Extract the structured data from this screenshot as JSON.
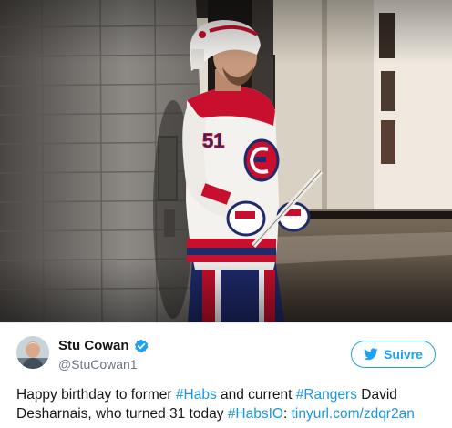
{
  "photo": {
    "jersey_number": "51"
  },
  "tweet": {
    "display_name": "Stu Cowan",
    "handle": "@StuCowan1",
    "follow_label": "Suivre",
    "text_parts": {
      "t1": "Happy birthday to former ",
      "hashtag_habs": "#Habs",
      "t2": " and current ",
      "hashtag_rangers": "#Rangers",
      "t3": " David Desharnais, who turned 31 today ",
      "hashtag_habsio": "#HabsIO",
      "t4": ": ",
      "link": "tinyurl.com/zdqr2an"
    }
  },
  "colors": {
    "accent": "#1da1f2",
    "link": "#1b95e0",
    "text": "#14171a",
    "muted": "#657786",
    "habs_red": "#c8102e"
  },
  "icons": {
    "verified": "verified-badge-icon",
    "follow": "twitter-bird-icon"
  }
}
